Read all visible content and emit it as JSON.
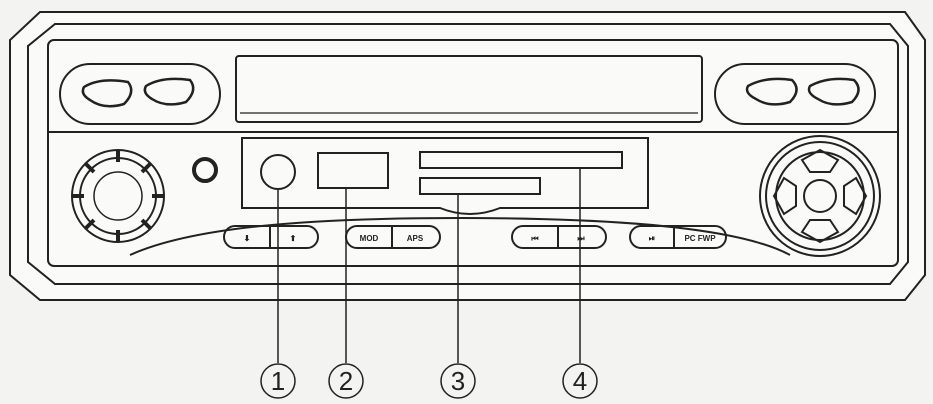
{
  "buttons": {
    "down": "⬇",
    "up": "⬆",
    "mod": "MOD",
    "aps": "APS",
    "prev": "⏮",
    "next": "⏭",
    "play_pause": "⏯",
    "pc_fwp": "PC FWP"
  },
  "callouts": [
    "1",
    "2",
    "3",
    "4"
  ],
  "colors": {
    "line": "#222222",
    "background": "#f3f3f1",
    "panel": "#fafaf8"
  }
}
